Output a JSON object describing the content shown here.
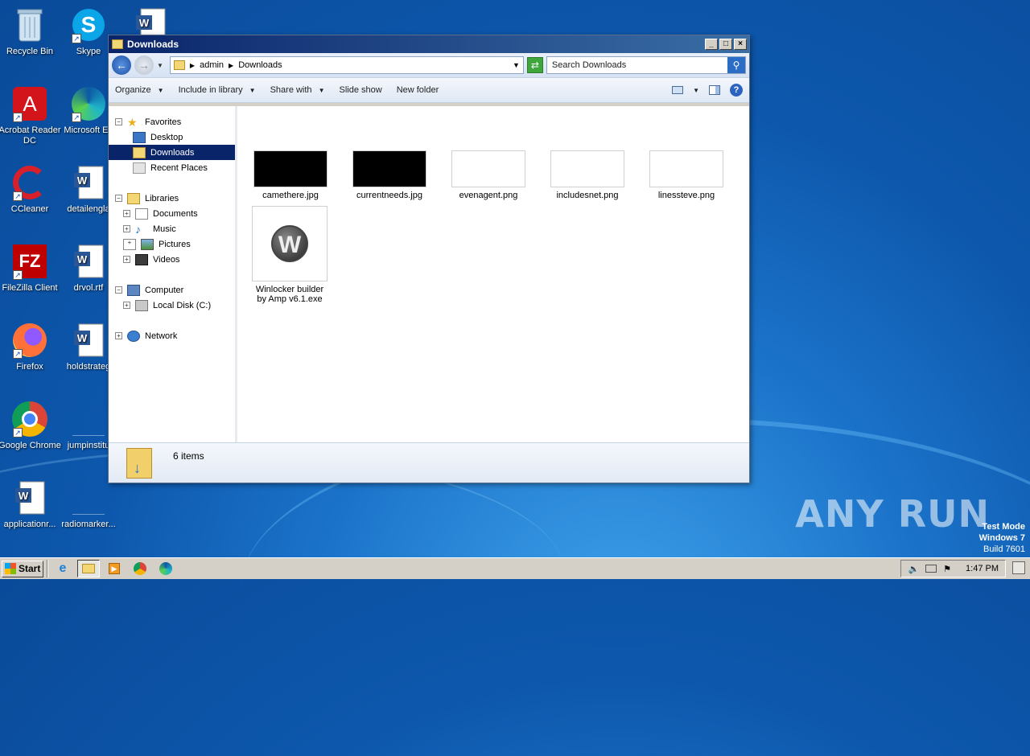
{
  "desktop": {
    "icons": [
      {
        "label": "Recycle Bin"
      },
      {
        "label": "Skype"
      },
      {
        "label": "Acrobat Reader DC"
      },
      {
        "label": "Microsoft Ed"
      },
      {
        "label": "CCleaner"
      },
      {
        "label": "detailengla"
      },
      {
        "label": "FileZilla Client"
      },
      {
        "label": "drvol.rtf"
      },
      {
        "label": "Firefox"
      },
      {
        "label": "holdstrateg"
      },
      {
        "label": "Google Chrome"
      },
      {
        "label": "jumpinstitu"
      },
      {
        "label": "applicationr..."
      },
      {
        "label": "radiomarker..."
      }
    ]
  },
  "window": {
    "title": "Downloads",
    "minimize": "_",
    "maximize": "□",
    "close": "×",
    "address": {
      "crumbs": [
        "admin",
        "Downloads"
      ]
    },
    "search": {
      "placeholder": "Search Downloads"
    },
    "toolbar": {
      "organize": "Organize",
      "include_in_library": "Include in library",
      "share_with": "Share with",
      "slide_show": "Slide show",
      "new_folder": "New folder"
    },
    "nav": {
      "favorites": "Favorites",
      "desktop": "Desktop",
      "downloads": "Downloads",
      "recent_places": "Recent Places",
      "libraries": "Libraries",
      "documents": "Documents",
      "music": "Music",
      "pictures": "Pictures",
      "videos": "Videos",
      "computer": "Computer",
      "local_disk": "Local Disk (C:)",
      "network": "Network"
    },
    "files": [
      {
        "name": "camethere.jpg"
      },
      {
        "name": "currentneeds.jpg"
      },
      {
        "name": "evenagent.png"
      },
      {
        "name": "includesnet.png"
      },
      {
        "name": "linessteve.png"
      },
      {
        "name_line1": "Winlocker builder",
        "name_line2": "by Amp v6.1.exe"
      }
    ],
    "status": {
      "count": "6 items"
    }
  },
  "taskbar": {
    "start": "Start",
    "clock": "1:47 PM"
  },
  "watermark": {
    "text": "ANY RUN"
  },
  "testmode": {
    "line1": "Test Mode",
    "line2": "Windows 7",
    "line3": "Build 7601"
  },
  "colors": {
    "accent": "#0a246a",
    "desktop": "#1b73c9"
  }
}
